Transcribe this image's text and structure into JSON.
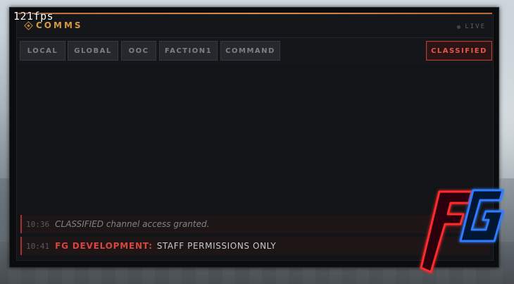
{
  "overlay": {
    "fps": "121fps"
  },
  "chat": {
    "title": "COMMS",
    "live_label": "LIVE",
    "tabs": [
      {
        "label": "LOCAL",
        "active": false
      },
      {
        "label": "GLOBAL",
        "active": false
      },
      {
        "label": "OOC",
        "active": false
      },
      {
        "label": "FACTION1",
        "active": false
      },
      {
        "label": "COMMAND",
        "active": false
      },
      {
        "label": "CLASSIFIED",
        "active": true
      }
    ],
    "messages": [
      {
        "time": "10:36",
        "text": "CLASSIFIED channel access granted.",
        "type": "system"
      },
      {
        "time": "10:41",
        "sender": "FG DEVELOPMENT:",
        "text": "STAFF PERMISSIONS ONLY",
        "type": "staff"
      }
    ]
  },
  "logo": {
    "text": "FG"
  },
  "colors": {
    "accent_orange": "#d49a45",
    "classified_red": "#e2574f",
    "logo_red": "#ff2a2a",
    "logo_blue": "#2d7bff"
  }
}
